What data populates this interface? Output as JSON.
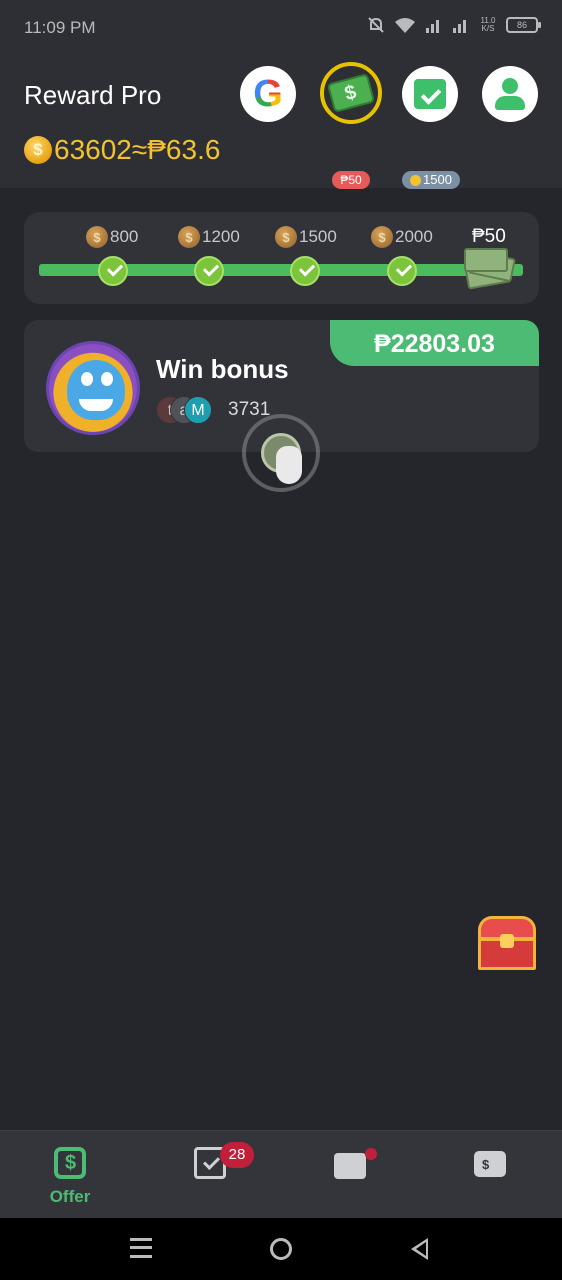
{
  "status_bar": {
    "time": "11:09 PM",
    "net_speed": "11.0 K/S",
    "battery": "86"
  },
  "header": {
    "title": "Reward Pro",
    "coins": "63602",
    "approx": "≈₱63.6",
    "cash_badge": "₱50",
    "checkin_badge": "1500",
    "icons": [
      "google-icon",
      "cash-icon",
      "calendar-check-icon",
      "profile-icon"
    ]
  },
  "progress": {
    "milestones": [
      {
        "label": "800",
        "done": true
      },
      {
        "label": "1200",
        "done": true
      },
      {
        "label": "1500",
        "done": true
      },
      {
        "label": "2000",
        "done": true
      }
    ],
    "final_reward": "₱50"
  },
  "offer": {
    "title": "Win bonus",
    "prize": "₱22803.03",
    "player_initials": [
      "t",
      "a",
      "M"
    ],
    "player_count": "3731"
  },
  "nav": {
    "items": [
      {
        "label": "Offer",
        "icon": "offer-icon",
        "active": true
      },
      {
        "label": "",
        "icon": "tasks-icon",
        "badge": "28"
      },
      {
        "label": "",
        "icon": "inbox-icon",
        "dot": true
      },
      {
        "label": "",
        "icon": "wallet-icon"
      }
    ]
  },
  "colors": {
    "accent": "#4cbb73",
    "gold": "#f2c230",
    "background": "#25262b",
    "badge": "#c0203a"
  }
}
